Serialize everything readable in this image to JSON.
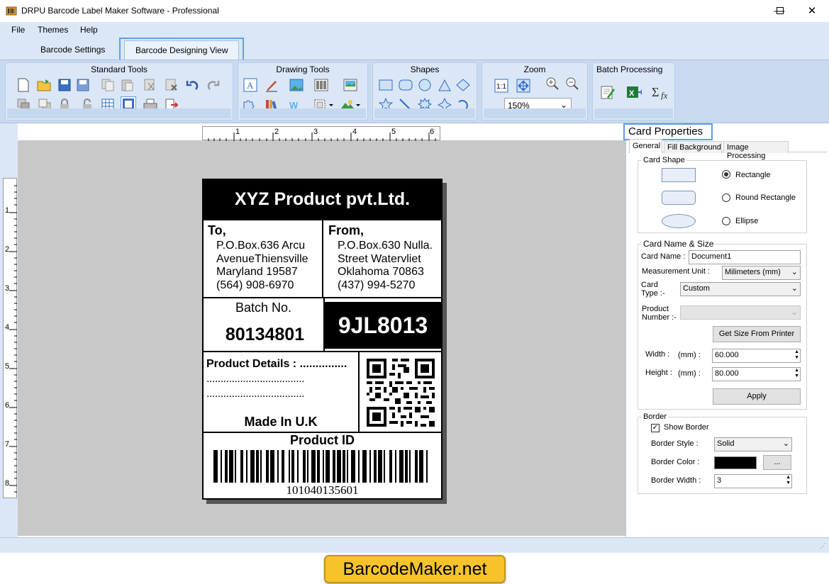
{
  "window": {
    "title": "DRPU Barcode Label Maker Software - Professional"
  },
  "menu": [
    "File",
    "Themes",
    "Help"
  ],
  "tabs": {
    "settings": "Barcode Settings",
    "designing": "Barcode Designing View"
  },
  "ribbon": {
    "standard": "Standard Tools",
    "drawing": "Drawing Tools",
    "shapes": "Shapes",
    "zoom": "Zoom",
    "zoom_value": "150%",
    "batch": "Batch Processing"
  },
  "ruler": {
    "h": [
      "1",
      "2",
      "3",
      "4",
      "5",
      "6"
    ],
    "v": [
      "1",
      "2",
      "3",
      "4",
      "5",
      "6",
      "7",
      "8"
    ]
  },
  "card": {
    "company": "XYZ Product pvt.Ltd.",
    "to_label": "To,",
    "to_lines": [
      "P.O.Box.636 Arcu",
      "AvenueThiensville",
      "Maryland 19587",
      "(564) 908-6970"
    ],
    "from_label": "From,",
    "from_lines": [
      "P.O.Box.630 Nulla.",
      "Street Watervliet",
      "Oklahoma 70863",
      "(437) 994-5270"
    ],
    "batch_label": "Batch No.",
    "batch_value": "80134801",
    "code_box": "9JL8013",
    "details_label": "Product Details : ...............",
    "dots1": "...................................",
    "dots2": "...................................",
    "made_in": "Made In U.K",
    "product_id_label": "Product ID",
    "barcode_number": "101040135601"
  },
  "properties": {
    "title": "Card Properties",
    "tabs": [
      "General",
      "Fill Background",
      "Image Processing"
    ],
    "card_shape_title": "Card Shape",
    "shapes": [
      "Rectangle",
      "Round Rectangle",
      "Ellipse"
    ],
    "name_size_title": "Card  Name & Size",
    "card_name_label": "Card Name :",
    "card_name_value": "Document1",
    "unit_label": "Measurement Unit :",
    "unit_value": "Milimeters (mm)",
    "card_type_label": "Card\nType :-",
    "card_type_value": "Custom",
    "product_number_label": "Product\nNumber :-",
    "get_size_button": "Get Size From Printer",
    "width_label": "Width :",
    "height_label": "Height :",
    "mm_label": "(mm) :",
    "width_value": "60.000",
    "height_value": "80.000",
    "apply_button": "Apply",
    "border_title": "Border",
    "show_border": "Show Border",
    "border_style_label": "Border Style :",
    "border_style_value": "Solid",
    "border_color_label": "Border Color :",
    "border_color_button": "...",
    "border_width_label": "Border Width :",
    "border_width_value": "3"
  },
  "brand": "BarcodeMaker.net"
}
